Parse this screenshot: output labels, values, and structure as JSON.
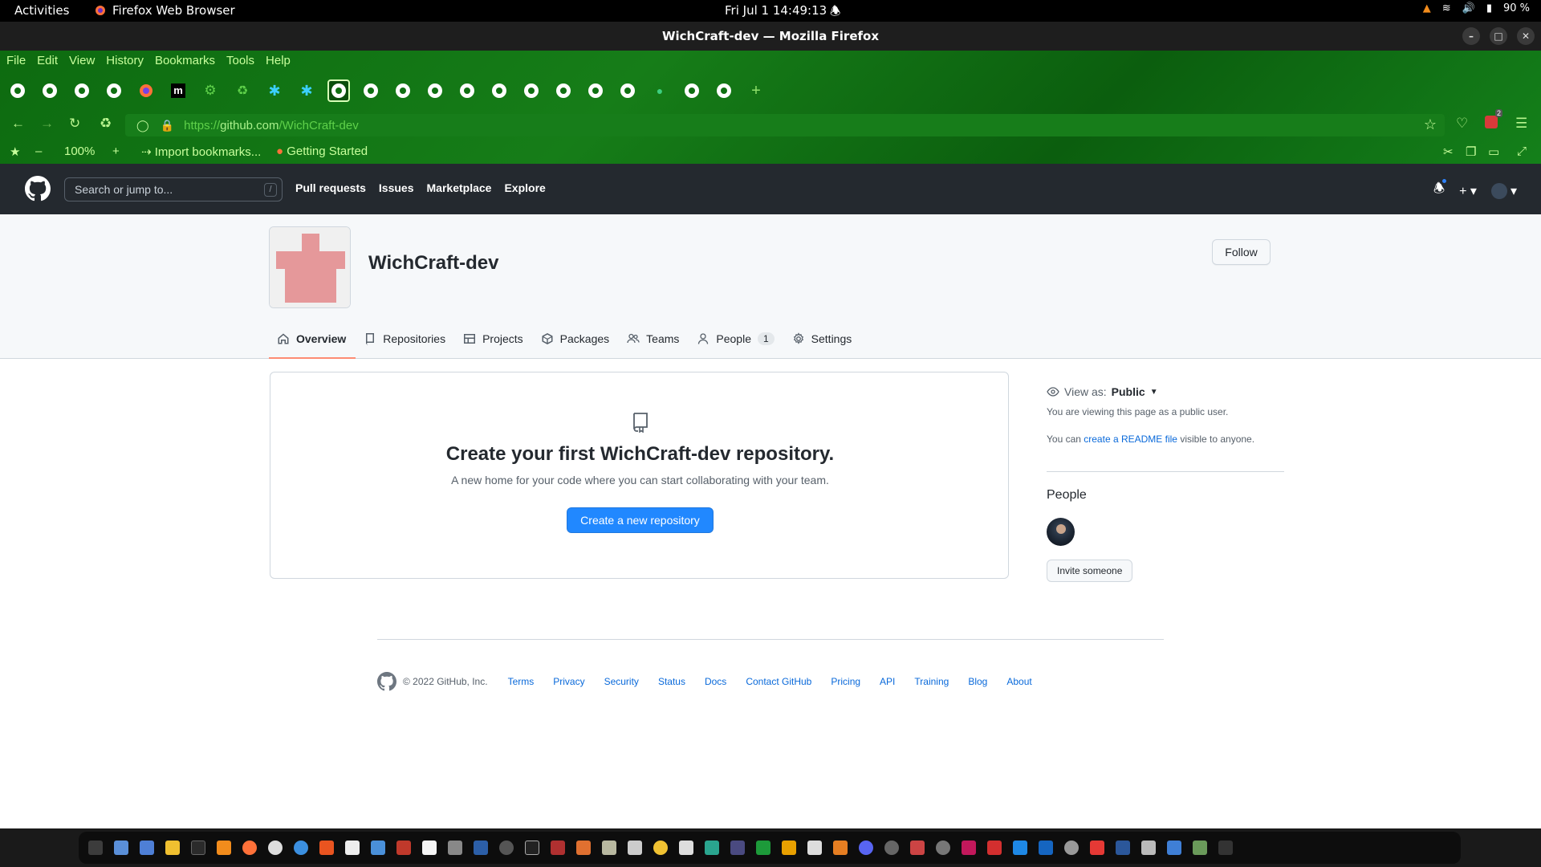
{
  "system_bar": {
    "activities": "Activities",
    "app": "Firefox Web Browser",
    "clock": "Fri Jul 1  14:49:13",
    "battery": "90 %"
  },
  "window": {
    "title": "WichCraft-dev — Mozilla Firefox"
  },
  "firefox": {
    "menu": [
      "File",
      "Edit",
      "View",
      "History",
      "Bookmarks",
      "Tools",
      "Help"
    ],
    "url_scheme": "https://",
    "url_host": "github.com",
    "url_path": "/WichCraft-dev",
    "zoom": "100%",
    "bookmarks": {
      "import": "Import bookmarks...",
      "getting_started": "Getting Started"
    },
    "extension_badge": "2"
  },
  "github_header": {
    "search_placeholder": "Search or jump to...",
    "search_key": "/",
    "nav": [
      "Pull requests",
      "Issues",
      "Marketplace",
      "Explore"
    ]
  },
  "org": {
    "name": "WichCraft-dev",
    "follow": "Follow",
    "avatar_color": "#e5989a",
    "tabs": {
      "overview": "Overview",
      "repositories": "Repositories",
      "projects": "Projects",
      "packages": "Packages",
      "teams": "Teams",
      "people": "People",
      "people_count": "1",
      "settings": "Settings"
    }
  },
  "blankslate": {
    "title": "Create your first WichCraft-dev repository.",
    "text": "A new home for your code where you can start collaborating with your team.",
    "button": "Create a new repository"
  },
  "sidebar": {
    "view_as_label": "View as:",
    "view_as_value": "Public",
    "viewing_note": "You are viewing this page as a public user.",
    "readme_prefix": "You can ",
    "readme_link": "create a README file",
    "readme_suffix": " visible to anyone.",
    "people_heading": "People",
    "invite": "Invite someone"
  },
  "footer": {
    "copyright": "© 2022 GitHub, Inc.",
    "links": [
      "Terms",
      "Privacy",
      "Security",
      "Status",
      "Docs",
      "Contact GitHub",
      "Pricing",
      "API",
      "Training",
      "Blog",
      "About"
    ]
  },
  "colors": {
    "firefox_theme": "#0d6b10",
    "github_header": "#24292f",
    "primary_button": "#2188ff",
    "tab_underline": "#fd8c73",
    "link": "#0969da"
  }
}
